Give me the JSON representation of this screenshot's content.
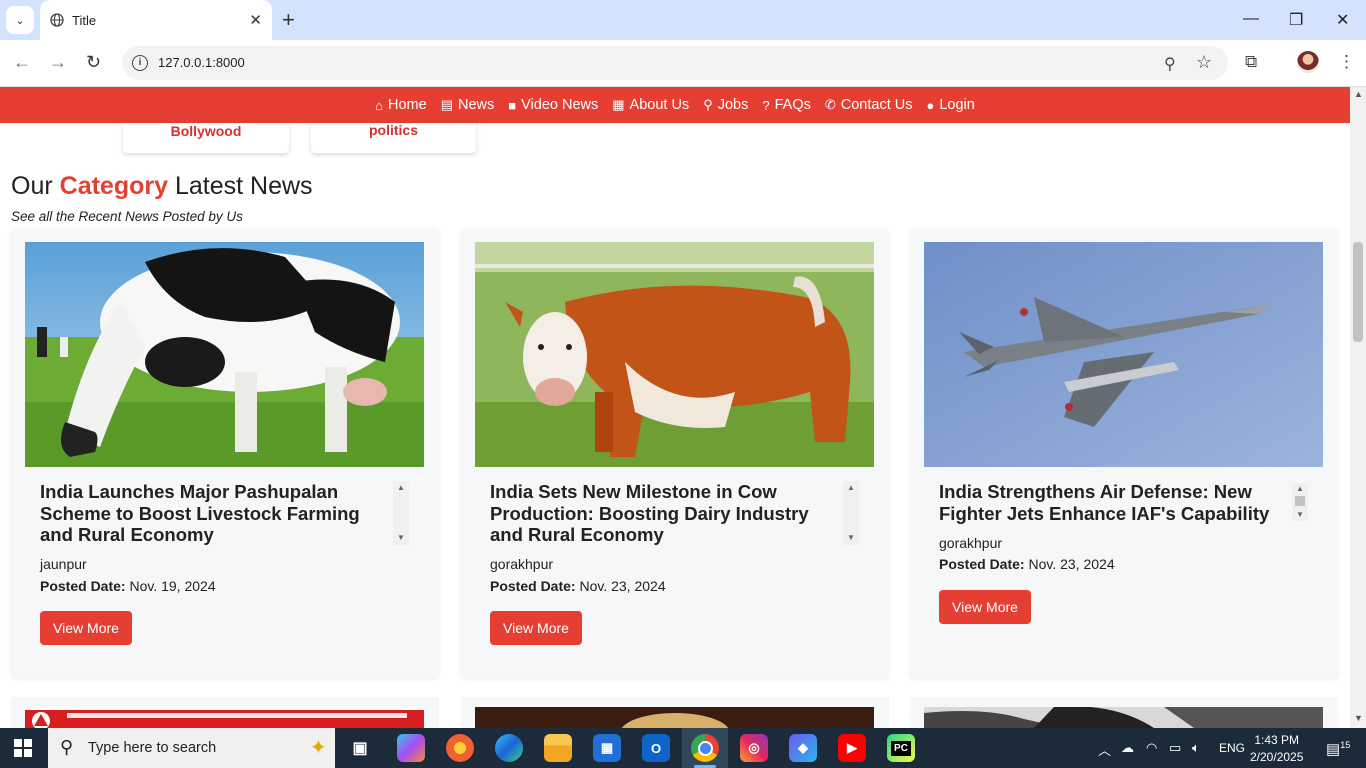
{
  "browser": {
    "tab_title": "Title",
    "url": "127.0.0.1:8000",
    "dropdown_glyph": "⌄",
    "close_glyph": "✕",
    "newtab_glyph": "+",
    "minimize_glyph": "—",
    "restore_glyph": "❐",
    "window_close_glyph": "✕",
    "back_glyph": "←",
    "forward_glyph": "→",
    "reload_glyph": "↻",
    "zoom_glyph": "⚲",
    "star_glyph": "☆",
    "extensions_glyph": "⧉",
    "menu_glyph": "⋮",
    "info_glyph": "i"
  },
  "nav": {
    "items": [
      {
        "label": "Home",
        "icon": "⌂"
      },
      {
        "label": "News",
        "icon": "▤"
      },
      {
        "label": "Video News",
        "icon": "■"
      },
      {
        "label": "About Us",
        "icon": "▦"
      },
      {
        "label": "Jobs",
        "icon": "⚲"
      },
      {
        "label": "FAQs",
        "icon": "?"
      },
      {
        "label": "Contact Us",
        "icon": "✆"
      },
      {
        "label": "Login",
        "icon": "●"
      }
    ]
  },
  "categories": [
    "Bollywood",
    "politics"
  ],
  "section": {
    "title_prefix": "Our",
    "title_highlight": "Category",
    "title_suffix": "Latest News",
    "subtitle": "See all the Recent News Posted by Us"
  },
  "cards": [
    {
      "headline": "India Launches Major Pashupalan Scheme to Boost Livestock Farming and Rural Economy",
      "city": "jaunpur",
      "date_label": "Posted Date:",
      "date": "Nov. 19, 2024",
      "button": "View More"
    },
    {
      "headline": "India Sets New Milestone in Cow Production: Boosting Dairy Industry and Rural Economy",
      "city": "gorakhpur",
      "date_label": "Posted Date:",
      "date": "Nov. 23, 2024",
      "button": "View More"
    },
    {
      "headline": "India Strengthens Air Defense: New Fighter Jets Enhance IAF's Capability",
      "city": "gorakhpur",
      "date_label": "Posted Date:",
      "date": "Nov. 23, 2024",
      "button": "View More"
    }
  ],
  "taskbar": {
    "search_placeholder": "Type here to search",
    "tray": {
      "language": "ENG",
      "time": "1:43 PM",
      "date": "2/20/2025",
      "notifications": "15"
    }
  },
  "colors": {
    "brand_red": "#e43f32",
    "taskbar": "#1c2b3a",
    "tabbar": "#d3e3fd"
  }
}
